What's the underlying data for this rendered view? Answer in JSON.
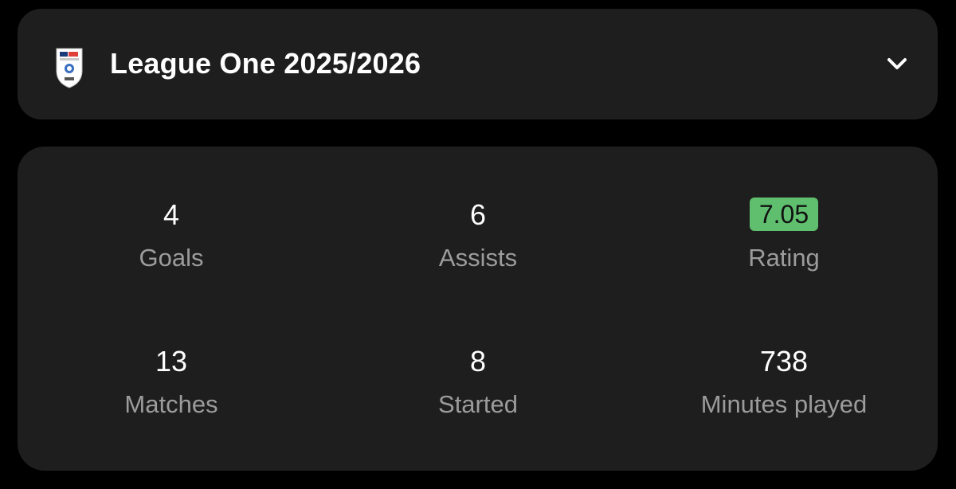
{
  "league": {
    "title": "League One 2025/2026",
    "logo_icon": "efl-league-one-logo-icon",
    "expand_icon": "chevron-down-icon"
  },
  "stats": {
    "goals": {
      "value": "4",
      "label": "Goals"
    },
    "assists": {
      "value": "6",
      "label": "Assists"
    },
    "rating": {
      "value": "7.05",
      "label": "Rating",
      "badge_color": "#5fbf6e"
    },
    "matches": {
      "value": "13",
      "label": "Matches"
    },
    "started": {
      "value": "8",
      "label": "Started"
    },
    "minutes": {
      "value": "738",
      "label": "Minutes played"
    }
  },
  "colors": {
    "background": "#000000",
    "card": "#1e1e1e",
    "value_text": "#ffffff",
    "label_text": "#9c9c9c"
  }
}
